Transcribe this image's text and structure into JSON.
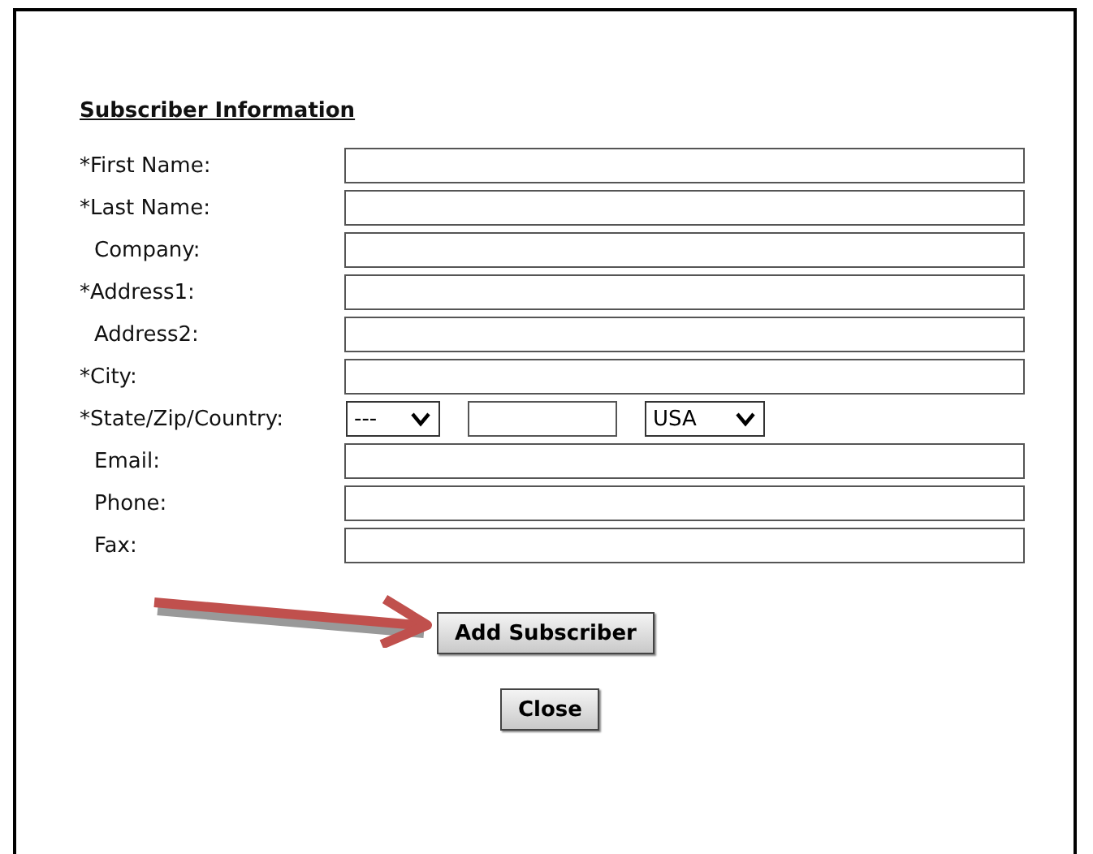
{
  "heading": "Subscriber Information",
  "rows": [
    {
      "kind": "text",
      "label": "*First Name:",
      "required": true
    },
    {
      "kind": "text",
      "label": "*Last Name:",
      "required": true
    },
    {
      "kind": "text",
      "label": "Company:",
      "required": false
    },
    {
      "kind": "text",
      "label": "*Address1:",
      "required": true
    },
    {
      "kind": "text",
      "label": "Address2:",
      "required": false
    },
    {
      "kind": "text",
      "label": "*City:",
      "required": true
    },
    {
      "kind": "location",
      "label": "*State/Zip/Country:",
      "required": true,
      "state": "---",
      "country": "USA"
    },
    {
      "kind": "text",
      "label": "Email:",
      "required": false
    },
    {
      "kind": "text",
      "label": "Phone:",
      "required": false
    },
    {
      "kind": "text",
      "label": "Fax:",
      "required": false
    }
  ],
  "buttons": {
    "add": "Add Subscriber",
    "close": "Close"
  }
}
